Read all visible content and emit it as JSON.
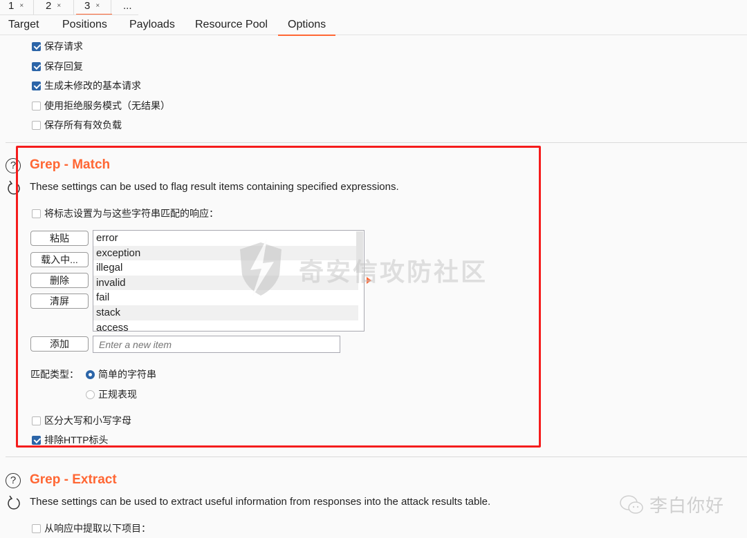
{
  "top_tabs": [
    {
      "label": "1",
      "close": "×"
    },
    {
      "label": "2",
      "close": "×"
    },
    {
      "label": "3",
      "close": "×",
      "active": true
    },
    {
      "label": "..."
    }
  ],
  "sub_tabs": [
    "Target",
    "Positions",
    "Payloads",
    "Resource Pool",
    "Options"
  ],
  "active_sub_tab": "Options",
  "results_options": [
    {
      "label": "保存请求",
      "checked": true
    },
    {
      "label": "保存回复",
      "checked": true
    },
    {
      "label": "生成未修改的基本请求",
      "checked": true
    },
    {
      "label": "使用拒绝服务模式（无结果）",
      "checked": false
    },
    {
      "label": "保存所有有效负载",
      "checked": false
    }
  ],
  "grep_match": {
    "help_icon": "?",
    "title": "Grep - Match",
    "description": "These settings can be used to flag result items containing specified expressions.",
    "flag_checkbox": {
      "label": "将标志设置为与这些字符串匹配的响应：",
      "checked": false
    },
    "buttons": {
      "paste": "粘贴",
      "load": "载入中...",
      "remove": "删除",
      "clear": "清屏",
      "add": "添加"
    },
    "items": [
      "error",
      "exception",
      "illegal",
      "invalid",
      "fail",
      "stack",
      "access"
    ],
    "new_item_placeholder": "Enter a new item",
    "match_type_label": "匹配类型：",
    "match_types": [
      {
        "label": "简单的字符串",
        "selected": true
      },
      {
        "label": "正规表现",
        "selected": false
      }
    ],
    "case_sensitive": {
      "label": "区分大写和小写字母",
      "checked": false
    },
    "exclude_headers": {
      "label": "排除HTTP标头",
      "checked": true
    }
  },
  "grep_extract": {
    "help_icon": "?",
    "title": "Grep - Extract",
    "description": "These settings can be used to extract useful information from responses into the attack results table.",
    "extract_checkbox": {
      "label": "从响应中提取以下项目：",
      "checked": false
    }
  },
  "watermark": {
    "text": "奇安信攻防社区"
  },
  "credit": {
    "text": "李白你好"
  },
  "colors": {
    "accent": "#ff6633",
    "highlight": "#f51c1c",
    "checkbox": "#2c65a8"
  }
}
